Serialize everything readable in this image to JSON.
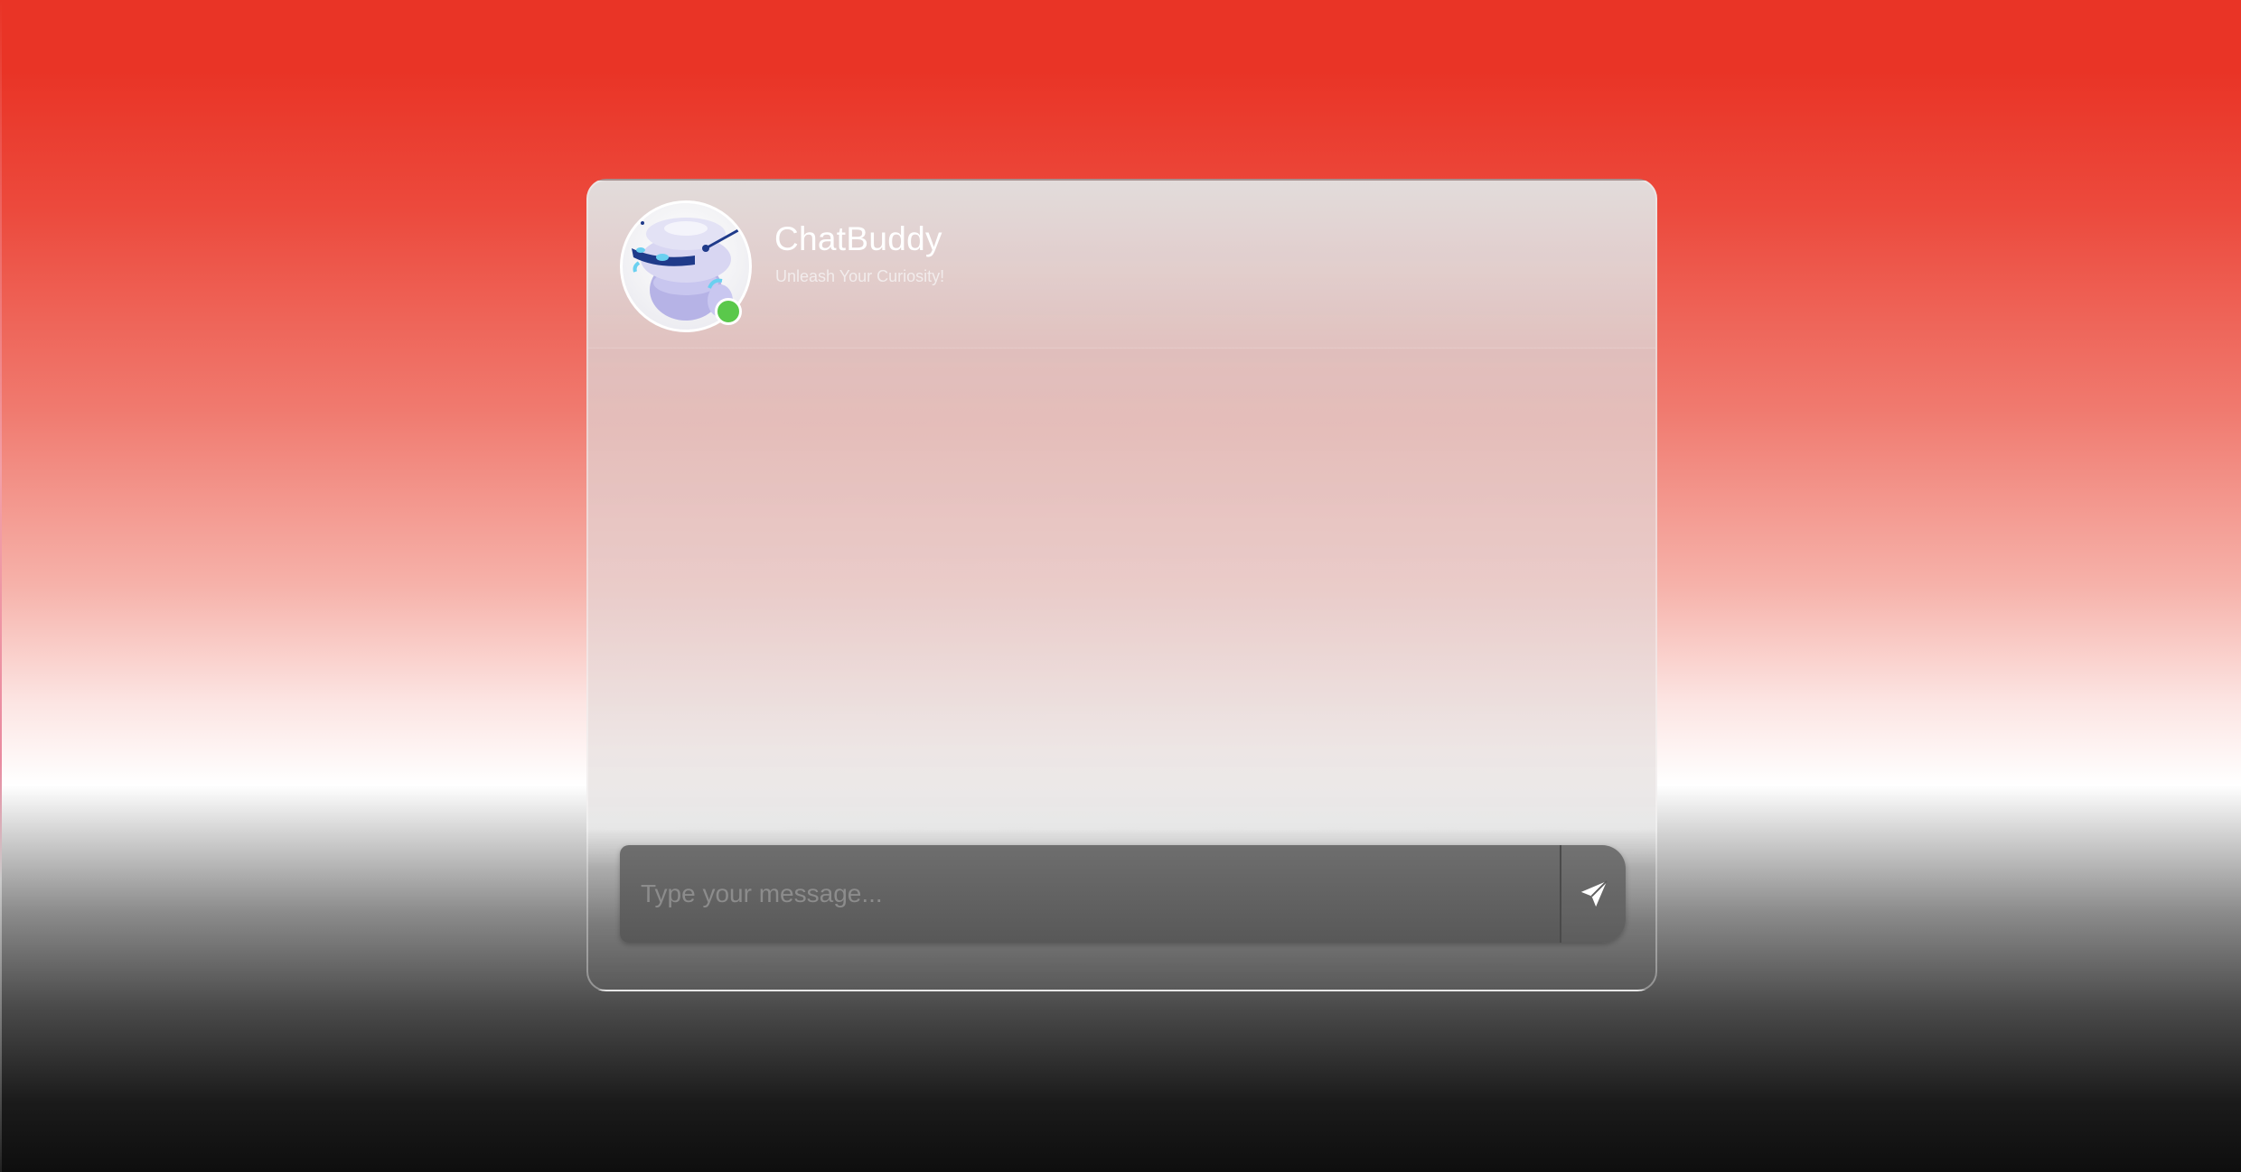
{
  "app": {
    "title": "ChatBuddy",
    "subtitle": "Unleash Your Curiosity!",
    "status": "online",
    "status_color": "#5ac84b",
    "avatar_icon": "robot-icon"
  },
  "composer": {
    "placeholder": "Type your message...",
    "value": "",
    "send_icon": "send-icon"
  },
  "messages": []
}
